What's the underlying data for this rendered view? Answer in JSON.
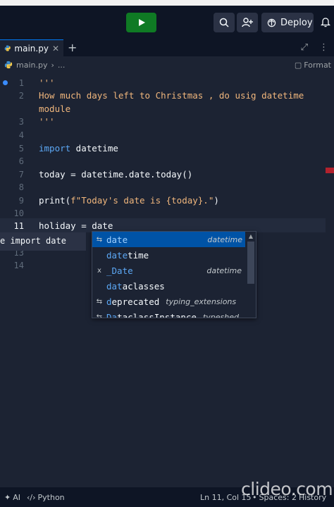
{
  "topbar": {
    "deploy_label": "Deploy"
  },
  "tabs": [
    {
      "label": "main.py"
    }
  ],
  "breadcrumb": {
    "file": "main.py",
    "ellipsis": "...",
    "format_label": "Format"
  },
  "editor": {
    "line_numbers": [
      "1",
      "2",
      "",
      "3",
      "4",
      "5",
      "6",
      "7",
      "8",
      "9",
      "10",
      "11",
      "",
      "13",
      "14"
    ],
    "lines": {
      "l1": "'''",
      "l2a": "How much days left to Christmas , do usig datetime",
      "l2b": "module",
      "l3": "'''",
      "l5_kw": "import",
      "l5_rest": " datetime",
      "l7": "today = datetime.date.today()",
      "l9_fn": "print(",
      "l9_str": "f\"Today's date is {today}.\"",
      "l9_end": ")",
      "l11": "holiday = date"
    },
    "inline_hint": "e import date"
  },
  "suggestions": [
    {
      "icon": "symbol-class-icon",
      "match": "date",
      "rest": "",
      "detail": "datetime",
      "selected": true
    },
    {
      "icon": "",
      "match": "date",
      "rest": "time",
      "detail": "",
      "selected": false
    },
    {
      "icon": "variable-icon",
      "match": "_Date",
      "rest": "",
      "detail": "datetime",
      "selected": false
    },
    {
      "icon": "",
      "match": "dat",
      "rest": "aclasses",
      "detail": "",
      "selected": false
    },
    {
      "icon": "symbol-class-icon",
      "match": "d",
      "rest": "eprecated",
      "detail": "typing_extensions",
      "selected": false
    },
    {
      "icon": "symbol-class-icon",
      "match": "Da",
      "rest": "taclassInstance",
      "detail": "typeshed",
      "selected": false
    }
  ],
  "statusbar": {
    "ai": "AI",
    "language": "Python",
    "position": "Ln 11, Col 15",
    "spaces": "Spaces: 2",
    "history": "History"
  },
  "watermark": "clideo.com",
  "colors": {
    "run_green": "#0f7a24",
    "selection_blue": "#0053a6",
    "string_orange": "#f0b67c",
    "keyword_blue": "#5ca8f5"
  }
}
